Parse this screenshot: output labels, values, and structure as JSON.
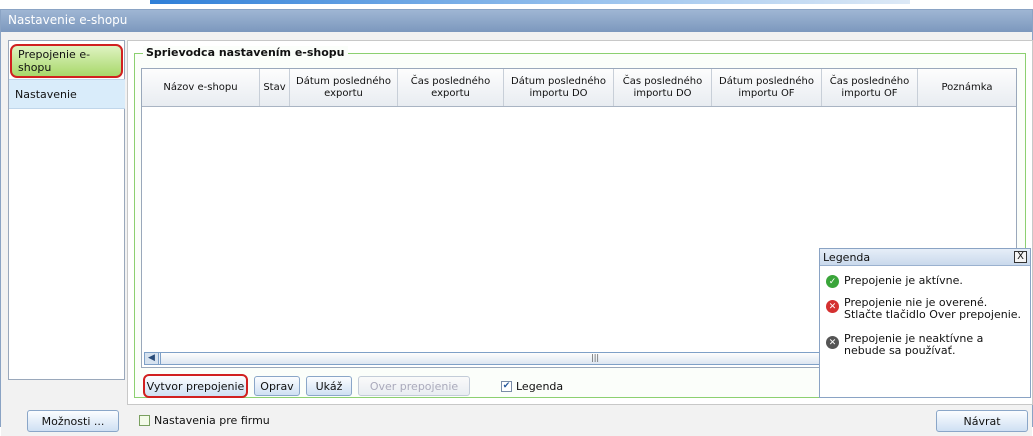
{
  "window": {
    "title": "Nastavenie e-shopu"
  },
  "sidebar": {
    "items": [
      {
        "label": "Prepojenie e-shopu",
        "selected": true
      },
      {
        "label": "Nastavenie",
        "selected": false
      }
    ]
  },
  "group": {
    "title": "Sprievodca nastavením e-shopu"
  },
  "grid": {
    "columns": [
      "Názov e-shopu",
      "Stav",
      "Dátum posledného exportu",
      "Čas posledného exportu",
      "Dátum posledného importu DO",
      "Čas posledného importu DO",
      "Dátum posledného importu OF",
      "Čas posledného importu OF",
      "Poznámka"
    ],
    "rows": []
  },
  "toolbar": {
    "create_label": "Vytvor prepojenie",
    "fix_label": "Oprav",
    "show_label": "Ukáž",
    "verify_label": "Over prepojenie",
    "legend_check_label": "Legenda",
    "legend_checked": true
  },
  "legend": {
    "title": "Legenda",
    "close_glyph": "X",
    "items": [
      {
        "icon": "check-circle-icon",
        "color": "#3aa53a",
        "text": "Prepojenie je aktívne."
      },
      {
        "icon": "error-circle-icon",
        "color": "#d43030",
        "text": "Prepojenie nie je overené. Stlačte tlačidlo Over prepojenie."
      },
      {
        "icon": "inactive-circle-icon",
        "color": "#555555",
        "text": "Prepojenie je neaktívne a nebude sa používať."
      }
    ]
  },
  "bottom": {
    "options_label": "Možnosti ...",
    "firm_settings_label": "Nastavenia pre firmu",
    "firm_settings_checked": false,
    "return_label": "Návrat"
  }
}
